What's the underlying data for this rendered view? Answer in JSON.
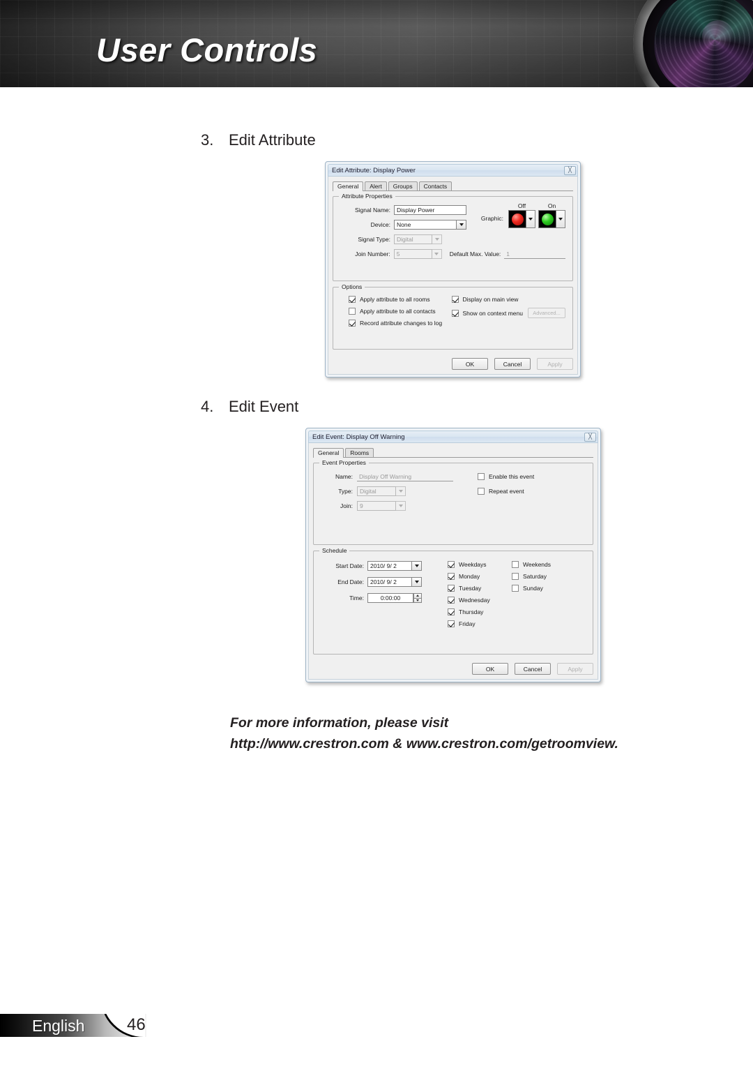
{
  "header": {
    "title": "User Controls"
  },
  "steps": [
    {
      "num": "3.",
      "label": "Edit Attribute"
    },
    {
      "num": "4.",
      "label": "Edit Event"
    }
  ],
  "edit_attribute_dialog": {
    "title": "Edit Attribute: Display Power",
    "close_icon": "close-icon",
    "tabs": [
      {
        "label": "General",
        "active": true
      },
      {
        "label": "Alert",
        "active": false
      },
      {
        "label": "Groups",
        "active": false
      },
      {
        "label": "Contacts",
        "active": false
      }
    ],
    "attribute_properties": {
      "legend": "Attribute Properties",
      "signal_name_label": "Signal Name:",
      "signal_name_value": "Display Power",
      "device_label": "Device:",
      "device_value": "None",
      "signal_type_label": "Signal Type:",
      "signal_type_value": "Digital",
      "join_number_label": "Join Number:",
      "join_number_value": "5",
      "default_max_label": "Default Max. Value:",
      "default_max_value": "1",
      "graphic_label": "Graphic:",
      "graphic_off_caption": "Off",
      "graphic_on_caption": "On",
      "graphic_off_color": "#ef2a20",
      "graphic_on_color": "#2fcc22"
    },
    "options": {
      "legend": "Options",
      "items": [
        {
          "label": "Apply attribute to all rooms",
          "checked": true
        },
        {
          "label": "Apply attribute to all contacts",
          "checked": false
        },
        {
          "label": "Record attribute changes to log",
          "checked": true
        },
        {
          "label": "Display on main view",
          "checked": true
        },
        {
          "label": "Show on context menu",
          "checked": true
        }
      ],
      "advanced_button": "Advanced..."
    },
    "buttons": {
      "ok": "OK",
      "cancel": "Cancel",
      "apply": "Apply"
    }
  },
  "edit_event_dialog": {
    "title": "Edit Event: Display Off Warning",
    "close_icon": "close-icon",
    "tabs": [
      {
        "label": "General",
        "active": true
      },
      {
        "label": "Rooms",
        "active": false
      }
    ],
    "event_properties": {
      "legend": "Event Properties",
      "name_label": "Name:",
      "name_value": "Display Off Warning",
      "type_label": "Type:",
      "type_value": "Digital",
      "join_label": "Join:",
      "join_value": "9",
      "enable_label": "Enable this event",
      "enable_checked": false,
      "repeat_label": "Repeat event",
      "repeat_checked": false
    },
    "schedule": {
      "legend": "Schedule",
      "start_date_label": "Start Date:",
      "start_date_value": "2010/ 9/ 2",
      "end_date_label": "End Date:",
      "end_date_value": "2010/ 9/ 2",
      "time_label": "Time:",
      "time_value": "0:00:00",
      "days_col1": [
        {
          "label": "Weekdays",
          "checked": true
        },
        {
          "label": "Monday",
          "checked": true
        },
        {
          "label": "Tuesday",
          "checked": true
        },
        {
          "label": "Wednesday",
          "checked": true
        },
        {
          "label": "Thursday",
          "checked": true
        },
        {
          "label": "Friday",
          "checked": true
        }
      ],
      "days_col2": [
        {
          "label": "Weekends",
          "checked": false
        },
        {
          "label": "Saturday",
          "checked": false
        },
        {
          "label": "Sunday",
          "checked": false
        }
      ]
    },
    "buttons": {
      "ok": "OK",
      "cancel": "Cancel",
      "apply": "Apply"
    }
  },
  "footnote": {
    "line1": "For more information, please visit",
    "line2": "http://www.crestron.com & www.crestron.com/getroomview."
  },
  "footer": {
    "language": "English",
    "page_number": "46"
  }
}
